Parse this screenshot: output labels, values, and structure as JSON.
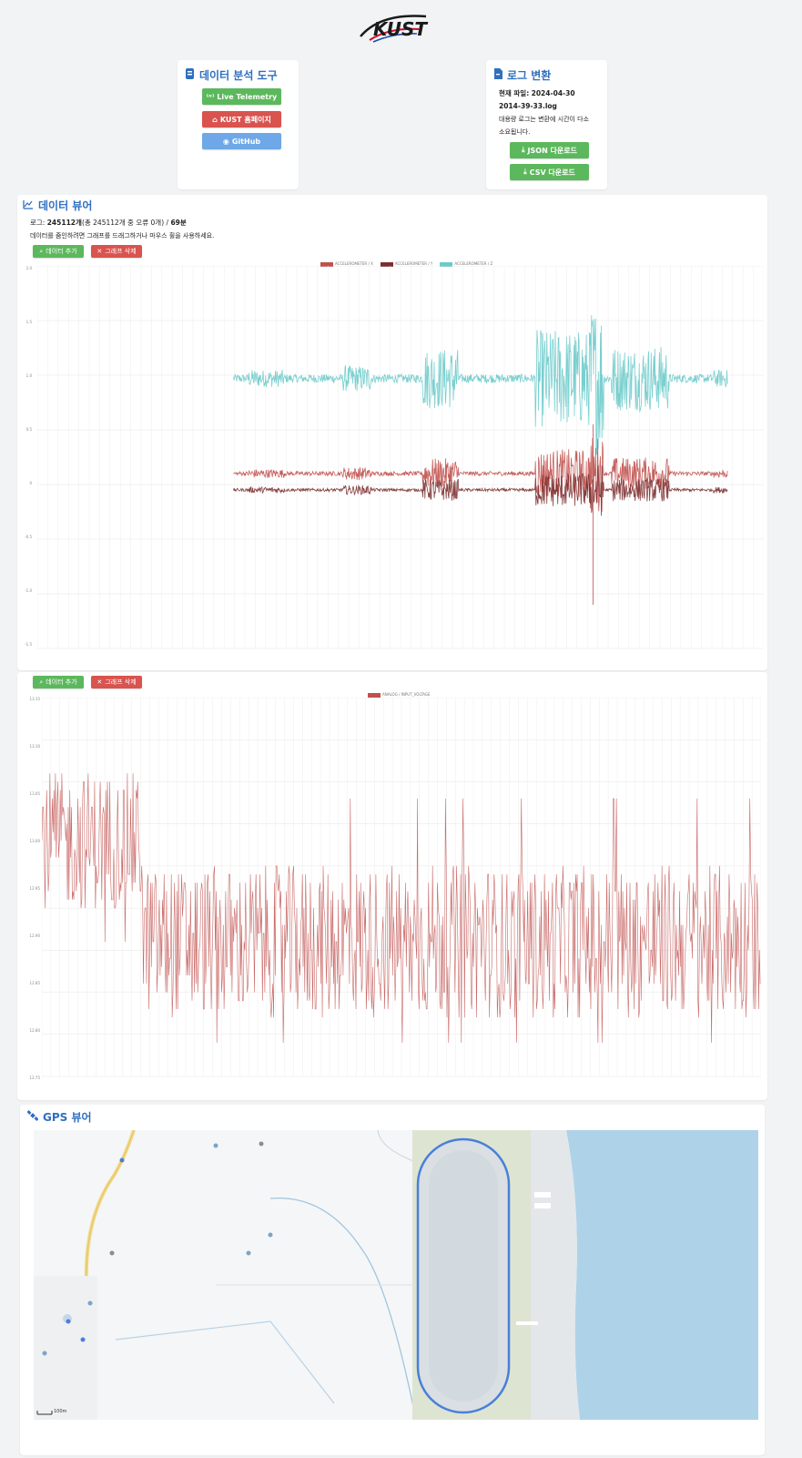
{
  "logo": {
    "text": "KUST"
  },
  "tools_card": {
    "title": "데이터 분석 도구",
    "buttons": {
      "live": "Live Telemetry",
      "home": "KUST 홈페이지",
      "github": "GitHub"
    }
  },
  "convert_card": {
    "title": "로그 변환",
    "file_label": "현재 파일:",
    "file_name_1": "2024-04-30",
    "file_name_2": "2014-39-33.log",
    "note_1": "대용량 로그는 변환에 시간이 다소",
    "note_2": "소요됩니다.",
    "json_button": "JSON 다운로드",
    "csv_button": "CSV 다운로드"
  },
  "viewer": {
    "title": "데이터 뷰어",
    "log_prefix": "로그:",
    "log_count": "245112개",
    "log_detail": "(총 245112개 중 오류 0개) /",
    "log_minutes": "69분",
    "hint": "데이터를 줌인하려면 그래프를 드래그하거나 마우스 휠을 사용하세요.",
    "add_data": "데이터 추가",
    "delete_graph": "그래프 삭제"
  },
  "colors": {
    "accent_blue": "#2f6fbf",
    "green": "#5cb85c",
    "red": "#d9534f",
    "series_x": "#c0504d",
    "series_y": "#7b2d2d",
    "series_z": "#6ccaca",
    "map_water": "#aed3e8"
  },
  "chart_data": [
    {
      "type": "line",
      "series": [
        {
          "name": "ACCELEROMETER / X",
          "baseline": 0.1,
          "color": "#c0504d"
        },
        {
          "name": "ACCELEROMETER / Y",
          "baseline": -0.05,
          "color": "#7b2d2d"
        },
        {
          "name": "ACCELEROMETER / Z",
          "baseline": 0.97,
          "color": "#6ccaca"
        }
      ],
      "y_ticks": [
        "2.0",
        "1.5",
        "1.0",
        "0.5",
        "0",
        "-0.5",
        "-1.0",
        "-1.5"
      ],
      "ylim": [
        -1.5,
        2.0
      ],
      "grid": true,
      "legend": "top-center"
    },
    {
      "type": "line",
      "series": [
        {
          "name": "ANALOG / INPUT_VOLTAGE",
          "color": "#c0504d"
        }
      ],
      "y_ticks": [
        "13.15",
        "13.10",
        "13.05",
        "13.00",
        "12.95",
        "12.90",
        "12.85",
        "12.80",
        "12.75",
        "12.70"
      ],
      "ylim": [
        12.7,
        13.15
      ],
      "grid": true,
      "legend": "top-center"
    }
  ],
  "gps": {
    "title": "GPS 뷰어",
    "scale": "100m"
  }
}
